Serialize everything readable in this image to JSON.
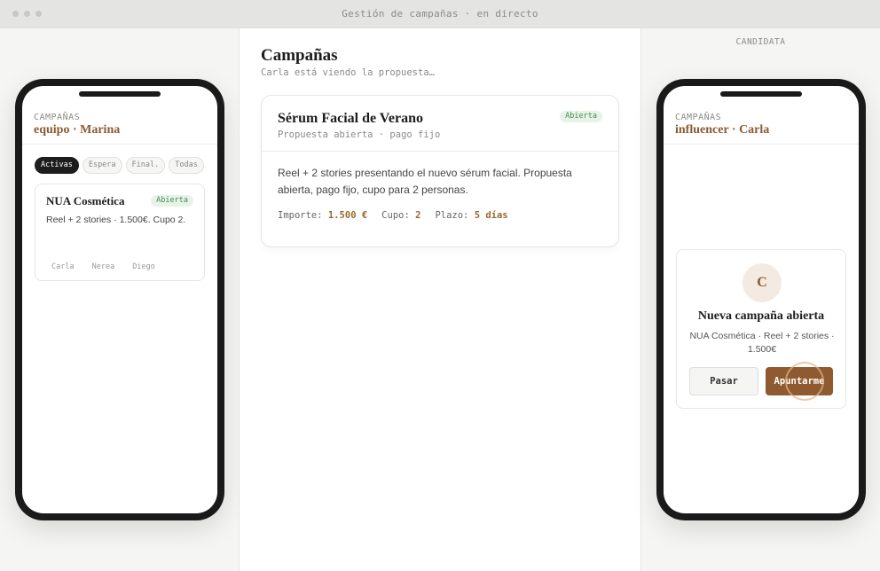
{
  "window": {
    "title": "Gestión de campañas · en directo"
  },
  "team_app": {
    "eyebrow": "CAMPAÑAS",
    "title": "equipo · Marina",
    "filters": [
      "Activas",
      "Espera",
      "Final.",
      "Todas"
    ],
    "active_filter": "Activas",
    "card": {
      "title": "NUA Cosmética",
      "status": "Abierta",
      "description": "Reel + 2 stories · 1.500€. Cupo 2.",
      "people": [
        "Carla",
        "Nerea",
        "Diego"
      ]
    }
  },
  "center": {
    "title": "Campañas",
    "subtitle": "Carla está viendo la propuesta…",
    "card": {
      "title": "Sérum Facial de Verano",
      "status": "Abierta",
      "subtitle": "Propuesta abierta · pago fijo",
      "description": "Reel + 2 stories presentando el nuevo sérum facial. Propuesta abierta, pago fijo, cupo para 2 personas.",
      "amount_label": "Importe:",
      "amount_value": "1.500 €",
      "quota_label": "Cupo:",
      "quota_value": "2",
      "deadline_label": "Plazo:",
      "deadline_value": "5 días"
    }
  },
  "influencer_app": {
    "panel_label": "CANDIDATA",
    "eyebrow": "CAMPAÑAS",
    "title": "influencer · Carla",
    "offer": {
      "avatar_initial": "C",
      "title": "Nueva campaña abierta",
      "description": "NUA Cosmética · Reel + 2 stories · 1.500€",
      "pass_label": "Pasar",
      "join_label": "Apuntarme"
    }
  },
  "colors": {
    "accent": "#8f5a2f",
    "badge_bg": "#e6f3e6",
    "badge_text": "#4a8a55"
  }
}
